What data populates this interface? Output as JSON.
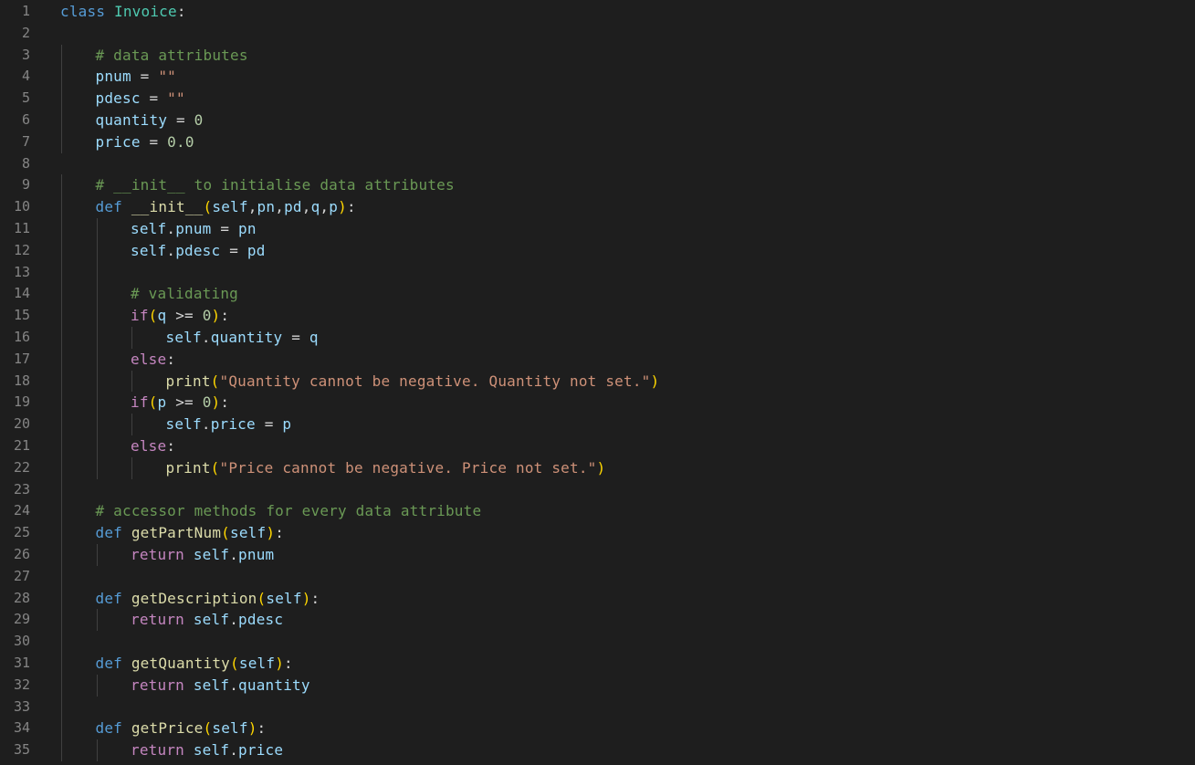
{
  "editor": {
    "language": "python",
    "lines": [
      {
        "num": "1",
        "indent": 0,
        "tokens": [
          [
            "kw",
            "class"
          ],
          [
            "plain",
            " "
          ],
          [
            "cls",
            "Invoice"
          ],
          [
            "plain",
            ":"
          ]
        ]
      },
      {
        "num": "2",
        "indent": 0,
        "tokens": []
      },
      {
        "num": "3",
        "indent": 1,
        "tokens": [
          [
            "cmt",
            "# data attributes"
          ]
        ]
      },
      {
        "num": "4",
        "indent": 1,
        "tokens": [
          [
            "var",
            "pnum"
          ],
          [
            "op",
            " = "
          ],
          [
            "str",
            "\"\""
          ]
        ]
      },
      {
        "num": "5",
        "indent": 1,
        "tokens": [
          [
            "var",
            "pdesc"
          ],
          [
            "op",
            " = "
          ],
          [
            "str",
            "\"\""
          ]
        ]
      },
      {
        "num": "6",
        "indent": 1,
        "tokens": [
          [
            "var",
            "quantity"
          ],
          [
            "op",
            " = "
          ],
          [
            "num",
            "0"
          ]
        ]
      },
      {
        "num": "7",
        "indent": 1,
        "tokens": [
          [
            "var",
            "price"
          ],
          [
            "op",
            " = "
          ],
          [
            "num",
            "0.0"
          ]
        ]
      },
      {
        "num": "8",
        "indent": 0,
        "tokens": []
      },
      {
        "num": "9",
        "indent": 1,
        "tokens": [
          [
            "cmt",
            "# __init__ to initialise data attributes"
          ]
        ]
      },
      {
        "num": "10",
        "indent": 1,
        "tokens": [
          [
            "kw",
            "def"
          ],
          [
            "plain",
            " "
          ],
          [
            "fn",
            "__init__"
          ],
          [
            "b1",
            "("
          ],
          [
            "param",
            "self"
          ],
          [
            "plain",
            ","
          ],
          [
            "param",
            "pn"
          ],
          [
            "plain",
            ","
          ],
          [
            "param",
            "pd"
          ],
          [
            "plain",
            ","
          ],
          [
            "param",
            "q"
          ],
          [
            "plain",
            ","
          ],
          [
            "param",
            "p"
          ],
          [
            "b1",
            ")"
          ],
          [
            "plain",
            ":"
          ]
        ]
      },
      {
        "num": "11",
        "indent": 2,
        "tokens": [
          [
            "self",
            "self"
          ],
          [
            "plain",
            "."
          ],
          [
            "var",
            "pnum"
          ],
          [
            "op",
            " = "
          ],
          [
            "param",
            "pn"
          ]
        ]
      },
      {
        "num": "12",
        "indent": 2,
        "tokens": [
          [
            "self",
            "self"
          ],
          [
            "plain",
            "."
          ],
          [
            "var",
            "pdesc"
          ],
          [
            "op",
            " = "
          ],
          [
            "param",
            "pd"
          ]
        ]
      },
      {
        "num": "13",
        "indent": 0,
        "tokens": [],
        "guides": 2
      },
      {
        "num": "14",
        "indent": 2,
        "tokens": [
          [
            "cmt",
            "# validating"
          ]
        ]
      },
      {
        "num": "15",
        "indent": 2,
        "tokens": [
          [
            "ctl",
            "if"
          ],
          [
            "b1",
            "("
          ],
          [
            "param",
            "q"
          ],
          [
            "op",
            " >= "
          ],
          [
            "num",
            "0"
          ],
          [
            "b1",
            ")"
          ],
          [
            "plain",
            ":"
          ]
        ]
      },
      {
        "num": "16",
        "indent": 3,
        "tokens": [
          [
            "self",
            "self"
          ],
          [
            "plain",
            "."
          ],
          [
            "var",
            "quantity"
          ],
          [
            "op",
            " = "
          ],
          [
            "param",
            "q"
          ]
        ]
      },
      {
        "num": "17",
        "indent": 2,
        "tokens": [
          [
            "ctl",
            "else"
          ],
          [
            "plain",
            ":"
          ]
        ]
      },
      {
        "num": "18",
        "indent": 3,
        "tokens": [
          [
            "fn",
            "print"
          ],
          [
            "b1",
            "("
          ],
          [
            "str",
            "\"Quantity cannot be negative. Quantity not set.\""
          ],
          [
            "b1",
            ")"
          ]
        ]
      },
      {
        "num": "19",
        "indent": 2,
        "tokens": [
          [
            "ctl",
            "if"
          ],
          [
            "b1",
            "("
          ],
          [
            "param",
            "p"
          ],
          [
            "op",
            " >= "
          ],
          [
            "num",
            "0"
          ],
          [
            "b1",
            ")"
          ],
          [
            "plain",
            ":"
          ]
        ]
      },
      {
        "num": "20",
        "indent": 3,
        "tokens": [
          [
            "self",
            "self"
          ],
          [
            "plain",
            "."
          ],
          [
            "var",
            "price"
          ],
          [
            "op",
            " = "
          ],
          [
            "param",
            "p"
          ]
        ]
      },
      {
        "num": "21",
        "indent": 2,
        "tokens": [
          [
            "ctl",
            "else"
          ],
          [
            "plain",
            ":"
          ]
        ]
      },
      {
        "num": "22",
        "indent": 3,
        "tokens": [
          [
            "fn",
            "print"
          ],
          [
            "b1",
            "("
          ],
          [
            "str",
            "\"Price cannot be negative. Price not set.\""
          ],
          [
            "b1",
            ")"
          ]
        ]
      },
      {
        "num": "23",
        "indent": 0,
        "tokens": [],
        "guides": 1
      },
      {
        "num": "24",
        "indent": 1,
        "tokens": [
          [
            "cmt",
            "# accessor methods for every data attribute"
          ]
        ]
      },
      {
        "num": "25",
        "indent": 1,
        "tokens": [
          [
            "kw",
            "def"
          ],
          [
            "plain",
            " "
          ],
          [
            "fn",
            "getPartNum"
          ],
          [
            "b1",
            "("
          ],
          [
            "param",
            "self"
          ],
          [
            "b1",
            ")"
          ],
          [
            "plain",
            ":"
          ]
        ]
      },
      {
        "num": "26",
        "indent": 2,
        "tokens": [
          [
            "ctl",
            "return"
          ],
          [
            "plain",
            " "
          ],
          [
            "self",
            "self"
          ],
          [
            "plain",
            "."
          ],
          [
            "var",
            "pnum"
          ]
        ]
      },
      {
        "num": "27",
        "indent": 0,
        "tokens": [],
        "guides": 1
      },
      {
        "num": "28",
        "indent": 1,
        "tokens": [
          [
            "kw",
            "def"
          ],
          [
            "plain",
            " "
          ],
          [
            "fn",
            "getDescription"
          ],
          [
            "b1",
            "("
          ],
          [
            "param",
            "self"
          ],
          [
            "b1",
            ")"
          ],
          [
            "plain",
            ":"
          ]
        ]
      },
      {
        "num": "29",
        "indent": 2,
        "tokens": [
          [
            "ctl",
            "return"
          ],
          [
            "plain",
            " "
          ],
          [
            "self",
            "self"
          ],
          [
            "plain",
            "."
          ],
          [
            "var",
            "pdesc"
          ]
        ]
      },
      {
        "num": "30",
        "indent": 0,
        "tokens": [],
        "guides": 1
      },
      {
        "num": "31",
        "indent": 1,
        "tokens": [
          [
            "kw",
            "def"
          ],
          [
            "plain",
            " "
          ],
          [
            "fn",
            "getQuantity"
          ],
          [
            "b1",
            "("
          ],
          [
            "param",
            "self"
          ],
          [
            "b1",
            ")"
          ],
          [
            "plain",
            ":"
          ]
        ]
      },
      {
        "num": "32",
        "indent": 2,
        "tokens": [
          [
            "ctl",
            "return"
          ],
          [
            "plain",
            " "
          ],
          [
            "self",
            "self"
          ],
          [
            "plain",
            "."
          ],
          [
            "var",
            "quantity"
          ]
        ]
      },
      {
        "num": "33",
        "indent": 0,
        "tokens": [],
        "guides": 1
      },
      {
        "num": "34",
        "indent": 1,
        "tokens": [
          [
            "kw",
            "def"
          ],
          [
            "plain",
            " "
          ],
          [
            "fn",
            "getPrice"
          ],
          [
            "b1",
            "("
          ],
          [
            "param",
            "self"
          ],
          [
            "b1",
            ")"
          ],
          [
            "plain",
            ":"
          ]
        ]
      },
      {
        "num": "35",
        "indent": 2,
        "tokens": [
          [
            "ctl",
            "return"
          ],
          [
            "plain",
            " "
          ],
          [
            "self",
            "self"
          ],
          [
            "plain",
            "."
          ],
          [
            "var",
            "price"
          ]
        ]
      }
    ]
  },
  "colors": {
    "background": "#1e1e1e",
    "line_number": "#858585",
    "keyword": "#569cd6",
    "control": "#c586c0",
    "class_name": "#4ec9b0",
    "function": "#dcdcaa",
    "variable": "#9cdcfe",
    "number": "#b5cea8",
    "string": "#ce9178",
    "comment": "#6a9955",
    "bracket": "#ffd700",
    "indent_guide": "#404040"
  }
}
